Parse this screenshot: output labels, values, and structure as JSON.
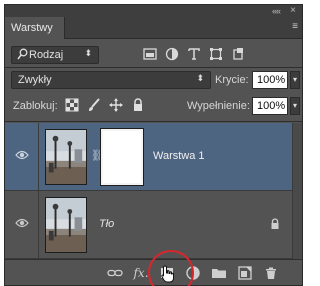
{
  "panel": {
    "tab_label": "Warstwy",
    "collapse_glyph": "««",
    "close_glyph": "×",
    "menu_glyph": "≡"
  },
  "filter": {
    "kind_label": "Rodzaj",
    "filter_icons": [
      "image-filter-icon",
      "adjustment-filter-icon",
      "type-filter-icon",
      "shape-filter-icon",
      "smart-object-filter-icon"
    ]
  },
  "blend": {
    "mode_value": "Zwykły",
    "opacity_label": "Krycie:",
    "opacity_value": "100%",
    "fill_label": "Wypełnienie:",
    "fill_value": "100%"
  },
  "lock": {
    "label": "Zablokuj:"
  },
  "layers": [
    {
      "name": "Warstwa 1",
      "selected": true,
      "has_mask": true,
      "locked": false
    },
    {
      "name": "Tło",
      "selected": false,
      "has_mask": false,
      "locked": true
    }
  ],
  "bottom_toolbar": {
    "icons": [
      "link-layers-icon",
      "fx-icon",
      "add-mask-icon",
      "adjustment-layer-icon",
      "new-group-icon",
      "new-layer-icon",
      "delete-layer-icon"
    ],
    "fx_label": "fx."
  },
  "colors": {
    "panel_bg": "#535353",
    "selected_layer": "#4e6582",
    "highlight_circle": "#d7262c"
  }
}
